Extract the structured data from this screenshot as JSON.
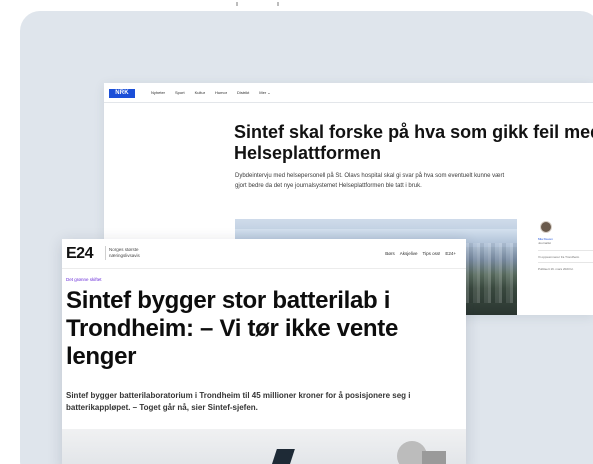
{
  "nrk": {
    "logo": "NRK",
    "nav": [
      "Nyheter",
      "Sport",
      "Kultur",
      "Humor",
      "Distrikt",
      "Mer ⌄"
    ],
    "title_line1": "Sintef skal forske på hva som gikk feil med",
    "title_line2": "Helseplattformen",
    "lead": "Dybdeintervju med helsepersonell på St. Olavs hospital skal gi svar på hva som eventuelt kunne vært gjort bedre da det nye journalsystemet Helseplattformen ble tatt i bruk.",
    "author_name": "Mia Kleven",
    "author_role": "Journalist",
    "side_note_1": "Vi oppsummerer fra Trondheim",
    "side_note_2": "Publisert 16. mars 2023 kl."
  },
  "e24": {
    "logo": "E24",
    "tagline": "Norges største næringslivsavis",
    "menu": [
      "Børs",
      "Aksjelive",
      "Tips oss!",
      "E24+"
    ],
    "kicker": "Det grønne skiftet",
    "title_lines": [
      "Sintef bygger stor batterilab i",
      "Trondheim: – Vi tør ikke vente",
      "lenger"
    ],
    "lead": "Sintef bygger batterilaboratorium i Trondheim til 45 millioner kroner for å posisjonere seg i batterikappløpet. – Toget går nå, sier Sintef-sjefen."
  },
  "colors": {
    "background_panel": "#dfe5ec",
    "nrk_blue": "#1b4fd8",
    "e24_kicker": "#6a2dd8"
  }
}
